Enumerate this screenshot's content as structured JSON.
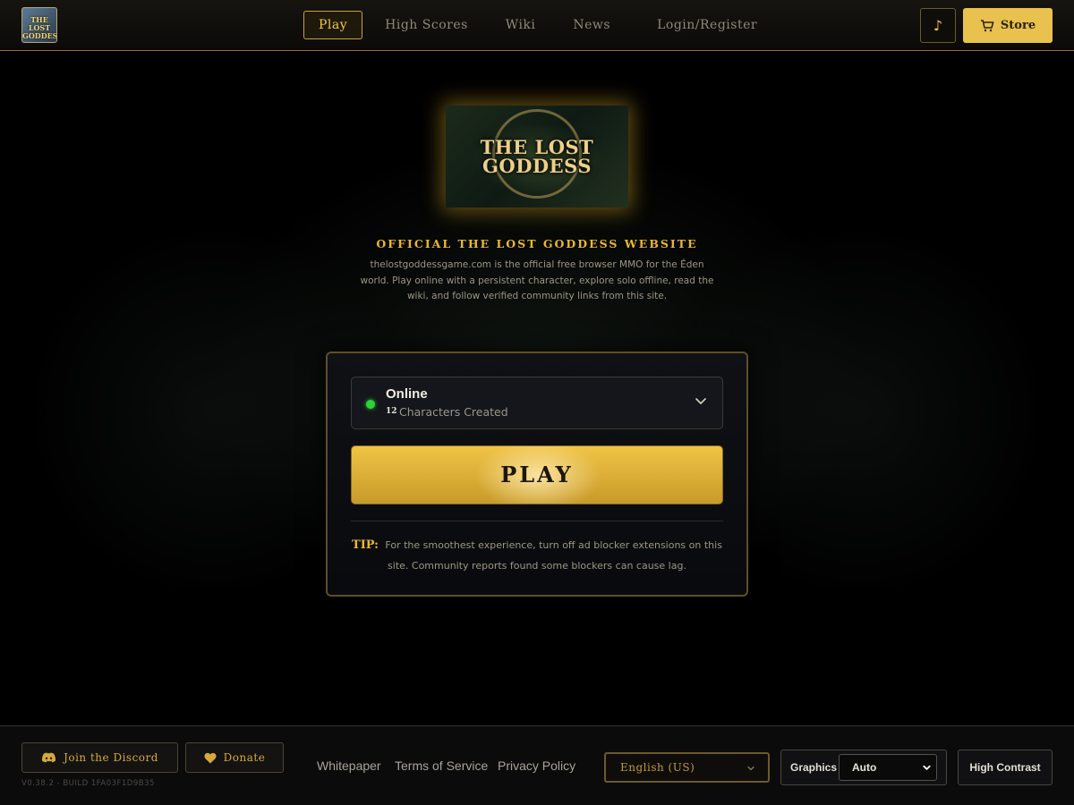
{
  "header": {
    "logo_text": "THE LOST GODDESS",
    "nav": [
      {
        "label": "Play"
      },
      {
        "label": "High Scores"
      },
      {
        "label": "Wiki"
      },
      {
        "label": "News"
      },
      {
        "label": "Login/Register"
      }
    ],
    "music_icon": "music-note-icon",
    "store_label": "Store",
    "store_icon": "cart-icon"
  },
  "hero": {
    "banner_text": "THE LOST GODDESS",
    "title": "OFFICIAL THE LOST GODDESS WEBSITE",
    "description": "thelostgoddessgame.com is the official free browser MMO for the Éden world. Play online with a persistent character, explore solo offline, read the wiki, and follow verified community links from this site."
  },
  "play_card": {
    "server": {
      "status": "Online",
      "status_color": "#2ed13a",
      "char_count": "12",
      "char_label": "Characters Created"
    },
    "play_label": "PLAY",
    "tip_label": "TIP:",
    "tip_text": "For the smoothest experience, turn off ad blocker extensions on this site. Community reports found some blockers can cause lag."
  },
  "footer": {
    "discord_label": "Join the Discord",
    "discord_icon": "discord-icon",
    "donate_label": "Donate",
    "donate_icon": "heart-icon",
    "version": "V0.38.2 - BUILD 1FA03F1D9B35",
    "links": [
      "Whitepaper",
      "Terms of Service",
      "Privacy Policy"
    ],
    "language": "English (US)",
    "graphics_label": "Graphics",
    "graphics_value": "Auto",
    "contrast_label": "High Contrast"
  },
  "colors": {
    "accent_gold": "#e9b82f",
    "button_gold": "#e8c14e",
    "status_green": "#2ed13a"
  }
}
